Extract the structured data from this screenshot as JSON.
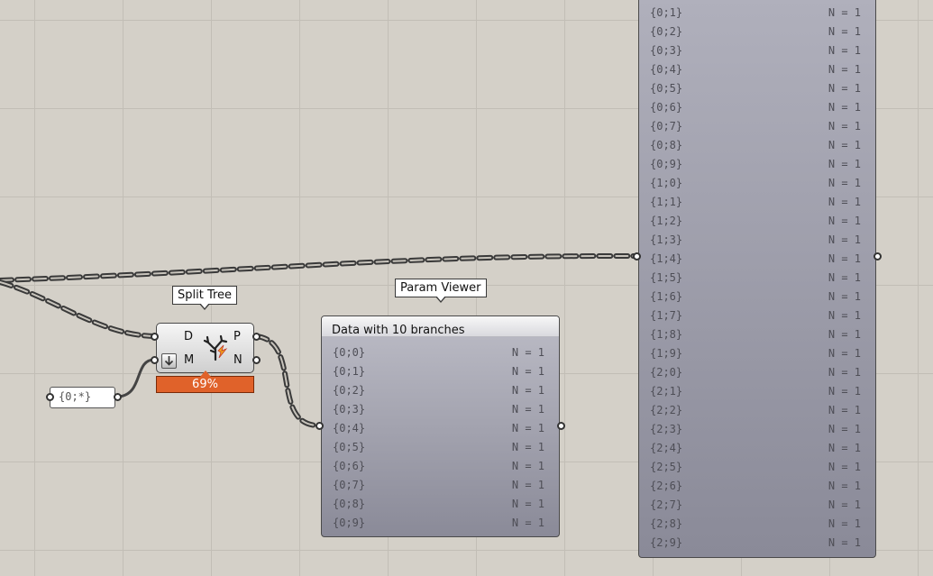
{
  "canvas": {
    "background": "#d4d0c8",
    "grid": true,
    "wire_color": "#444444"
  },
  "split_tree": {
    "tooltip": "Split Tree",
    "inputs": [
      "D",
      "M"
    ],
    "outputs": [
      "P",
      "N"
    ],
    "icon": "split-tree-icon",
    "progress": "69%",
    "progress_color": "#e0622a"
  },
  "mask_panel": {
    "value": "{0;*}"
  },
  "param_viewer_small": {
    "tooltip": "Param Viewer",
    "header": "Data with 10 branches",
    "rows": [
      {
        "path": "{0;0}",
        "count": "N = 1"
      },
      {
        "path": "{0;1}",
        "count": "N = 1"
      },
      {
        "path": "{0;2}",
        "count": "N = 1"
      },
      {
        "path": "{0;3}",
        "count": "N = 1"
      },
      {
        "path": "{0;4}",
        "count": "N = 1"
      },
      {
        "path": "{0;5}",
        "count": "N = 1"
      },
      {
        "path": "{0;6}",
        "count": "N = 1"
      },
      {
        "path": "{0;7}",
        "count": "N = 1"
      },
      {
        "path": "{0;8}",
        "count": "N = 1"
      },
      {
        "path": "{0;9}",
        "count": "N = 1"
      }
    ]
  },
  "param_viewer_large": {
    "rows": [
      {
        "path": "{0;1}",
        "count": "N = 1"
      },
      {
        "path": "{0;2}",
        "count": "N = 1"
      },
      {
        "path": "{0;3}",
        "count": "N = 1"
      },
      {
        "path": "{0;4}",
        "count": "N = 1"
      },
      {
        "path": "{0;5}",
        "count": "N = 1"
      },
      {
        "path": "{0;6}",
        "count": "N = 1"
      },
      {
        "path": "{0;7}",
        "count": "N = 1"
      },
      {
        "path": "{0;8}",
        "count": "N = 1"
      },
      {
        "path": "{0;9}",
        "count": "N = 1"
      },
      {
        "path": "{1;0}",
        "count": "N = 1"
      },
      {
        "path": "{1;1}",
        "count": "N = 1"
      },
      {
        "path": "{1;2}",
        "count": "N = 1"
      },
      {
        "path": "{1;3}",
        "count": "N = 1"
      },
      {
        "path": "{1;4}",
        "count": "N = 1"
      },
      {
        "path": "{1;5}",
        "count": "N = 1"
      },
      {
        "path": "{1;6}",
        "count": "N = 1"
      },
      {
        "path": "{1;7}",
        "count": "N = 1"
      },
      {
        "path": "{1;8}",
        "count": "N = 1"
      },
      {
        "path": "{1;9}",
        "count": "N = 1"
      },
      {
        "path": "{2;0}",
        "count": "N = 1"
      },
      {
        "path": "{2;1}",
        "count": "N = 1"
      },
      {
        "path": "{2;2}",
        "count": "N = 1"
      },
      {
        "path": "{2;3}",
        "count": "N = 1"
      },
      {
        "path": "{2;4}",
        "count": "N = 1"
      },
      {
        "path": "{2;5}",
        "count": "N = 1"
      },
      {
        "path": "{2;6}",
        "count": "N = 1"
      },
      {
        "path": "{2;7}",
        "count": "N = 1"
      },
      {
        "path": "{2;8}",
        "count": "N = 1"
      },
      {
        "path": "{2;9}",
        "count": "N = 1"
      }
    ]
  }
}
